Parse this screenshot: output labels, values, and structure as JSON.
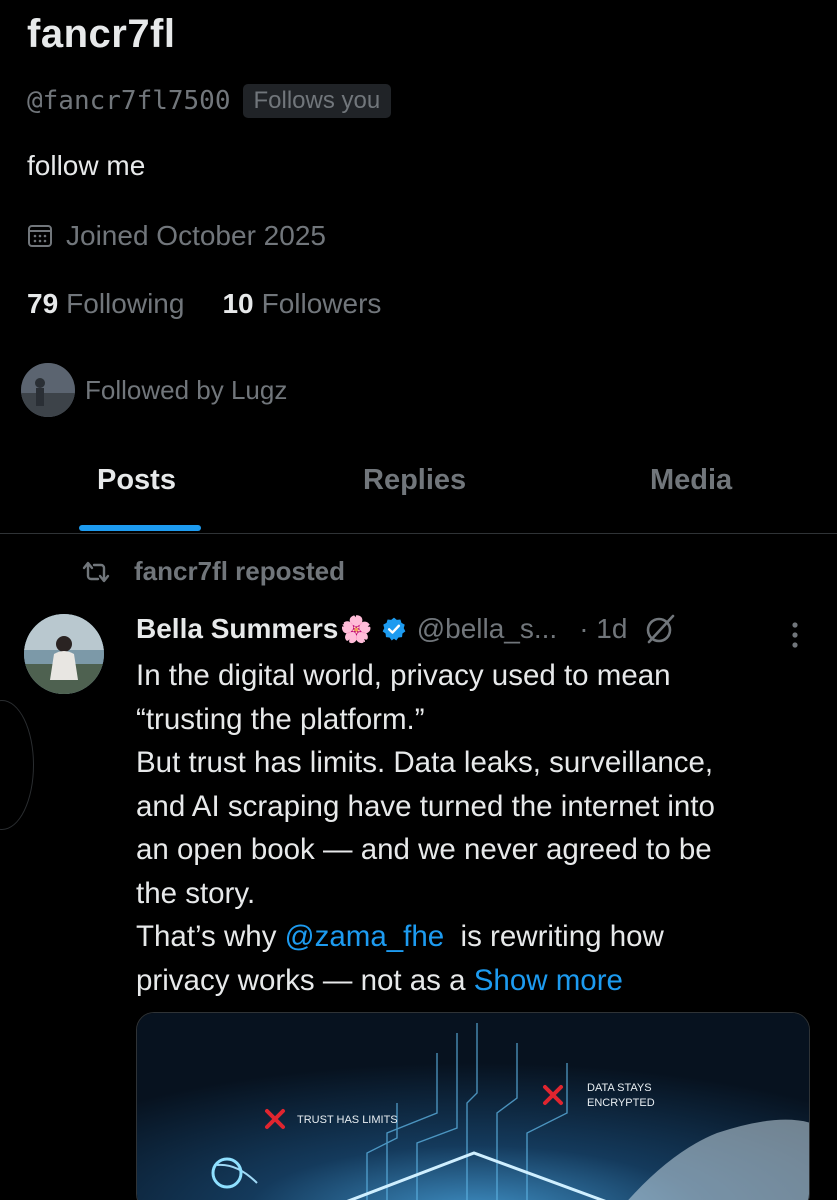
{
  "profile": {
    "display_name": "fancr7fl",
    "handle": "@fancr7fl7500",
    "follows_you_badge": "Follows you",
    "bio": "follow me",
    "joined": "Joined October 2025",
    "following_count": "79",
    "following_label": "Following",
    "followers_count": "10",
    "followers_label": "Followers",
    "followed_by": "Followed by Lugz"
  },
  "tabs": [
    {
      "label": "Posts",
      "active": true
    },
    {
      "label": "Replies",
      "active": false
    },
    {
      "label": "Media",
      "active": false
    }
  ],
  "post": {
    "repost_label": "fancr7fl reposted",
    "author_name": "Bella Summers",
    "author_emoji": "🌸",
    "author_handle": "@bella_s...",
    "time": "· 1d",
    "lines": {
      "l1": "In the digital world, privacy used to mean",
      "l2": "“trusting the platform.”",
      "l3": "But trust has limits. Data leaks, surveillance,",
      "l4": "and AI scraping have turned the internet into",
      "l5": "an open book — and we never agreed to be",
      "l6": "the story.",
      "l7_prefix": "That’s why ",
      "l7_mention": "@zama_fhe",
      "l7_suffix": "  is rewriting how",
      "l8_prefix": "privacy works — not as a ",
      "show_more": "Show more"
    },
    "media": {
      "label_left": "TRUST HAS LIMITS",
      "label_right_1": "DATA STAYS",
      "label_right_2": "ENCRYPTED"
    }
  },
  "colors": {
    "background": "#000000",
    "text_primary": "#e7e9ea",
    "text_secondary": "#71767b",
    "accent": "#1d9bf0",
    "divider": "#2f3336",
    "warning_red": "#e0252f"
  },
  "icons": {
    "calendar": "calendar-icon",
    "repost": "repost-icon",
    "verified": "verified-badge-icon",
    "grok": "grok-icon",
    "more": "more-vertical-icon"
  }
}
